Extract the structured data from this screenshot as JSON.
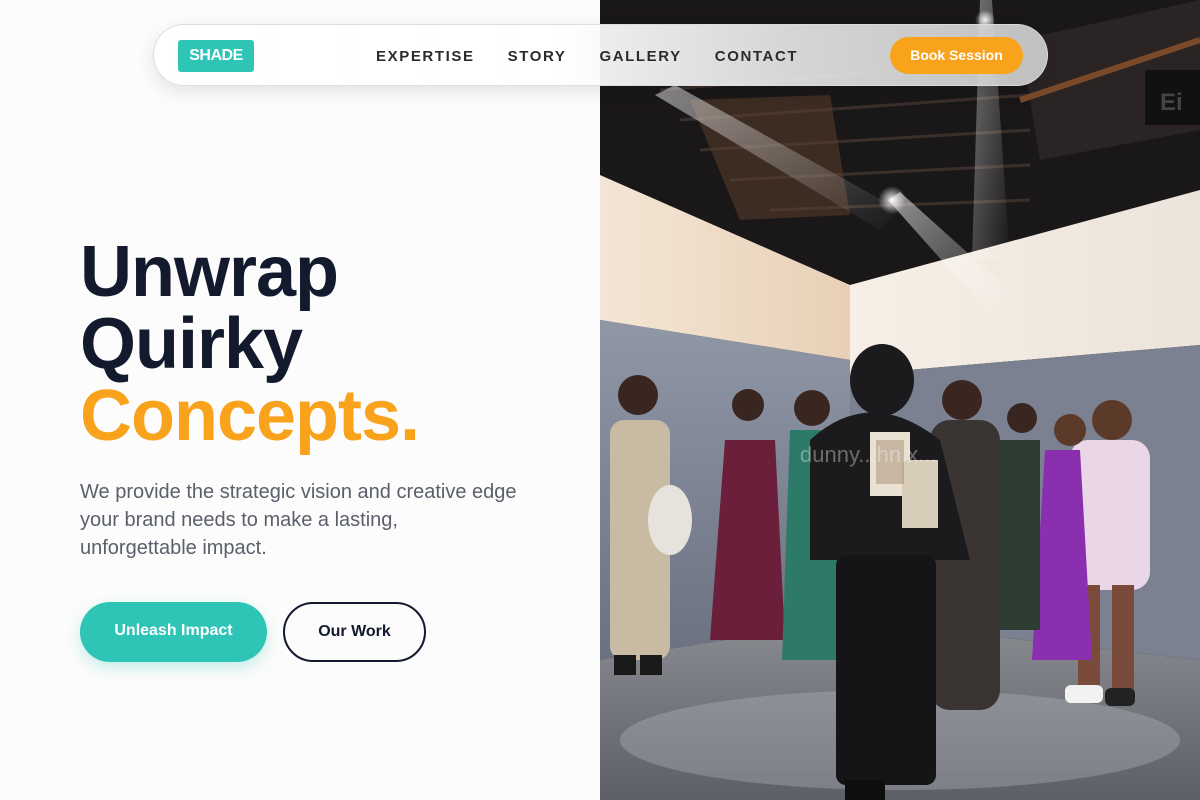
{
  "nav": {
    "logo": "SHADE",
    "links": [
      "EXPERTISE",
      "STORY",
      "GALLERY",
      "CONTACT"
    ],
    "cta": "Book Session"
  },
  "hero": {
    "headline": [
      "Unwrap",
      "Quirky",
      "Concepts."
    ],
    "lead": "We provide the strategic vision and creative edge your brand needs to make a lasting, unforgettable impact.",
    "primary_button": "Unleash Impact",
    "secondary_button": "Our Work"
  },
  "image": {
    "description_icon": "fashion-event-photo",
    "watermark": "dunny...hn.x..."
  },
  "colors": {
    "accent_teal": "#2ec4b6",
    "accent_orange": "#f9a21b",
    "ink": "#141a2d",
    "text_muted": "#5a5f6b"
  }
}
